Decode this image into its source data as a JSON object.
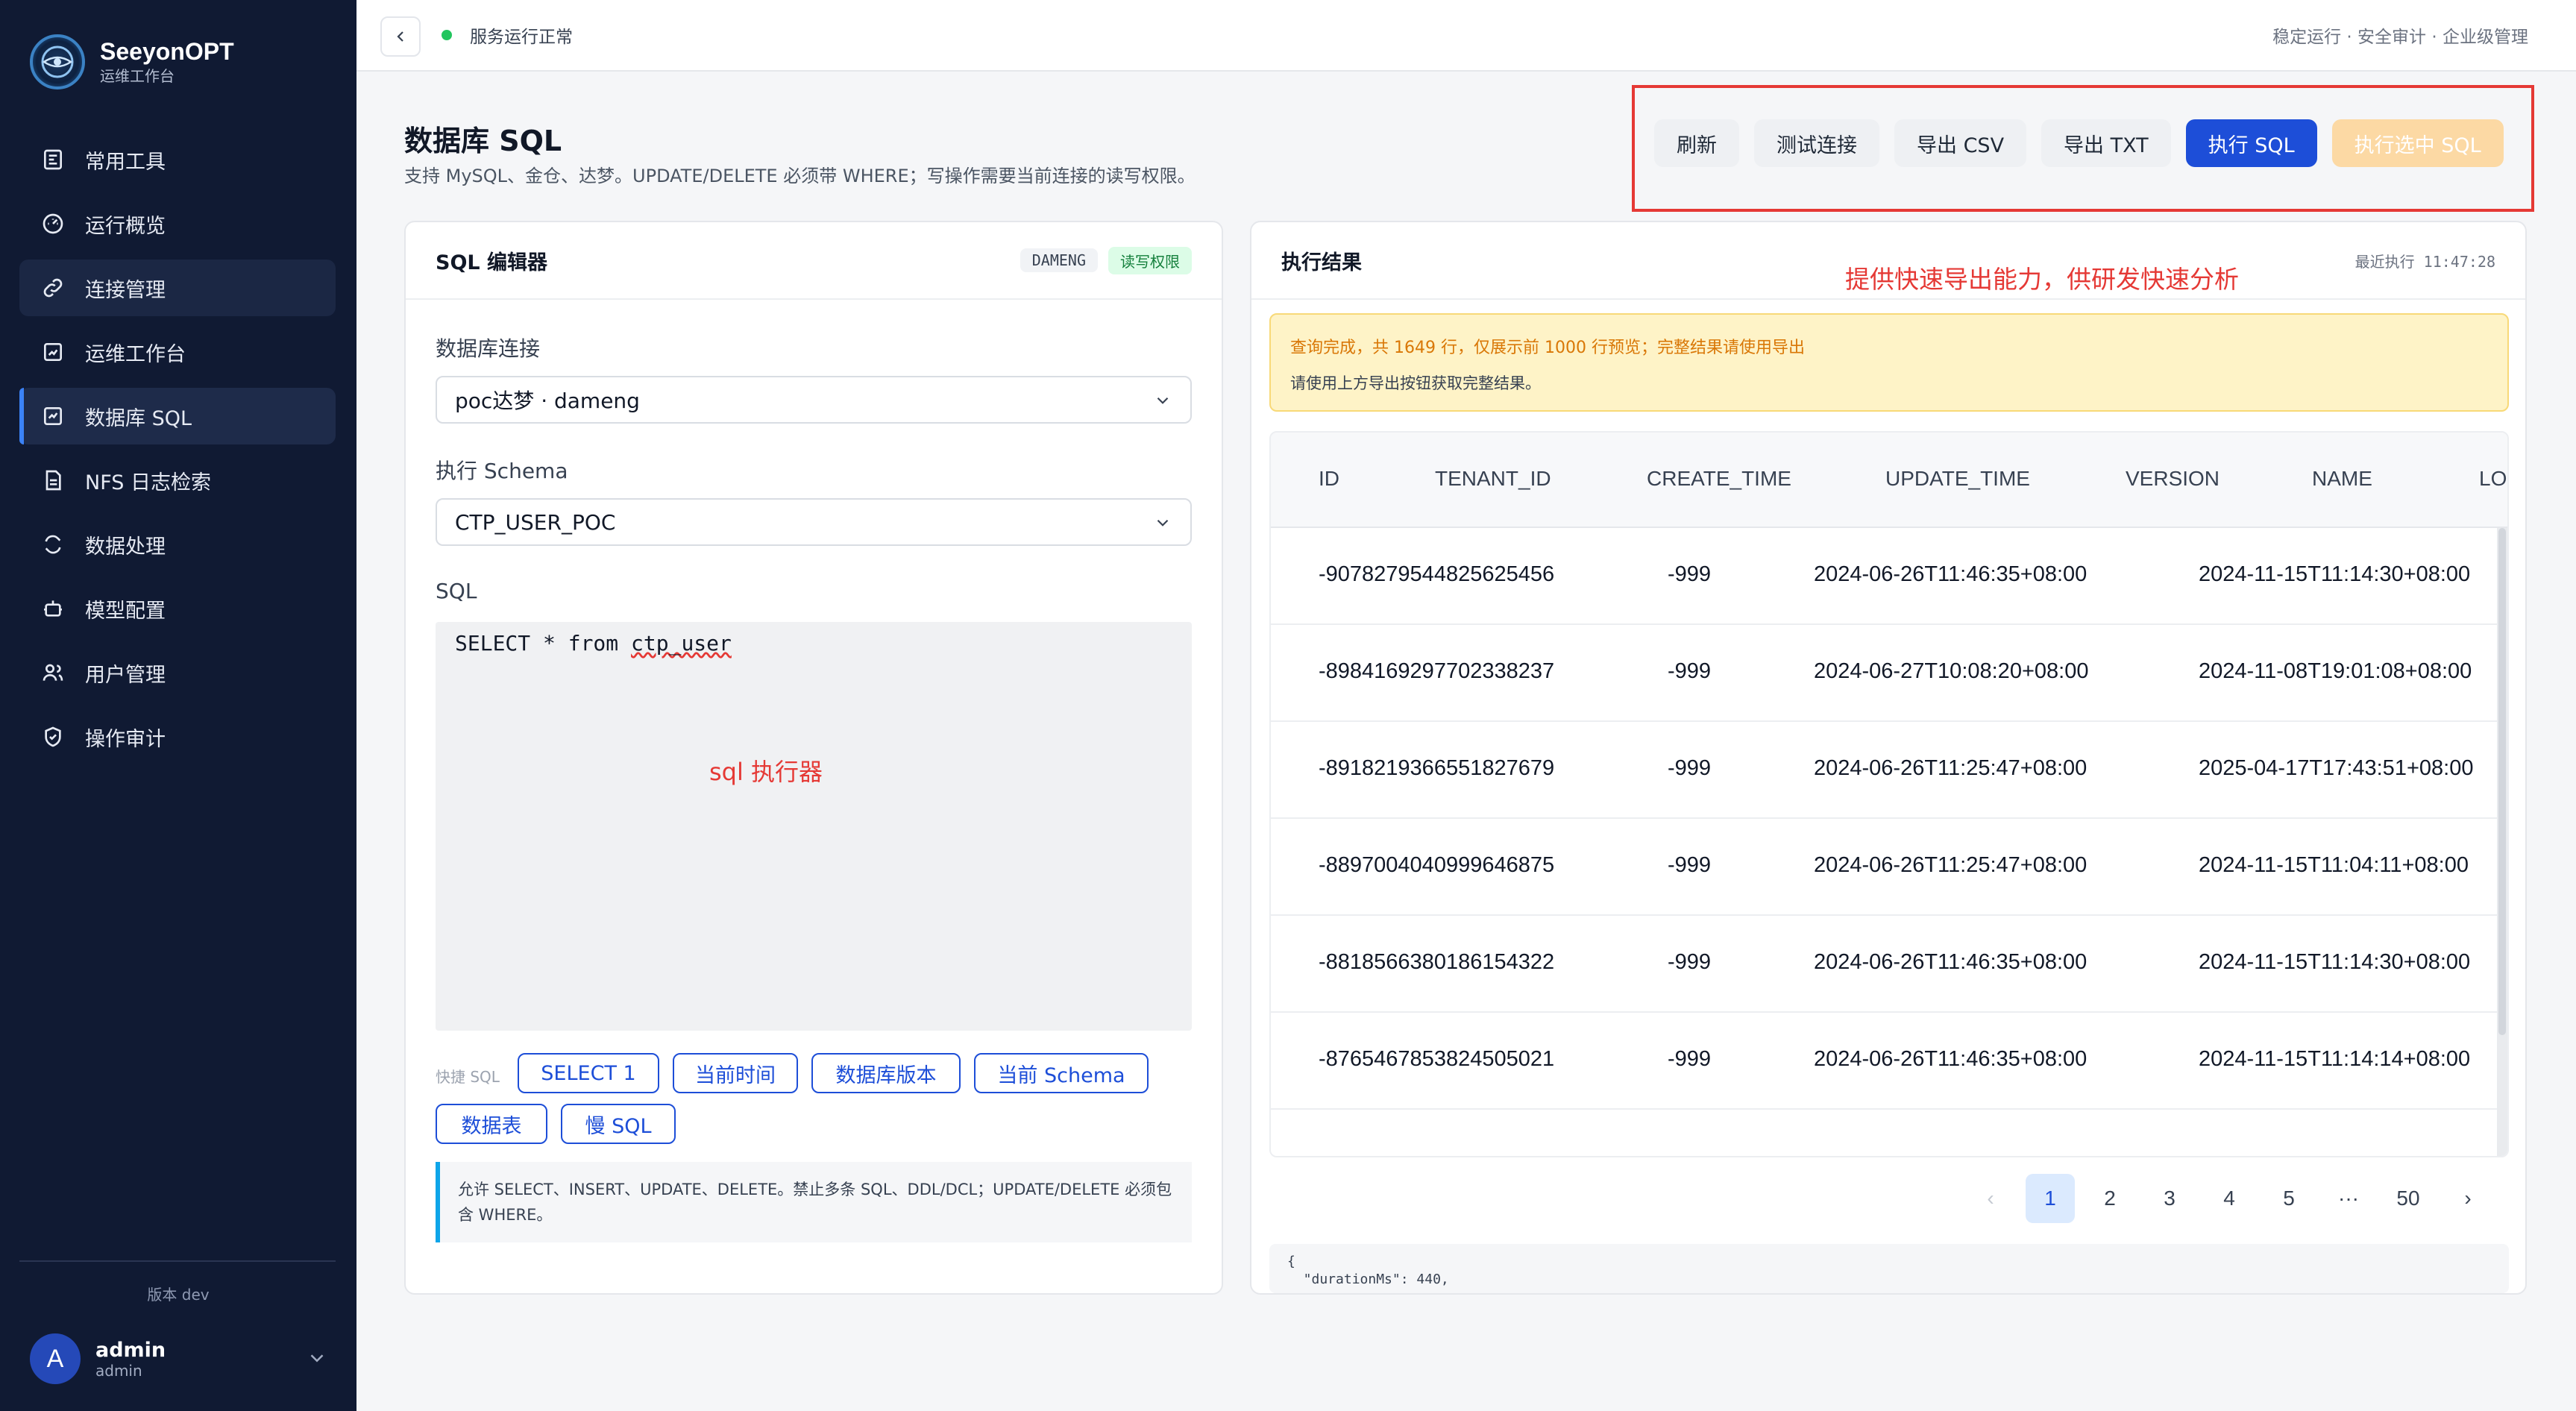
{
  "brand": {
    "title": "SeeyonOPT",
    "subtitle": "运维工作台"
  },
  "sidebar": {
    "items": [
      {
        "label": "常用工具",
        "icon": "tools-icon"
      },
      {
        "label": "运行概览",
        "icon": "gauge-icon"
      },
      {
        "label": "连接管理",
        "icon": "link-icon"
      },
      {
        "label": "运维工作台",
        "icon": "workbench-icon"
      },
      {
        "label": "数据库 SQL",
        "icon": "database-icon"
      },
      {
        "label": "NFS 日志检索",
        "icon": "file-icon"
      },
      {
        "label": "数据处理",
        "icon": "refresh-icon"
      },
      {
        "label": "模型配置",
        "icon": "robot-icon"
      },
      {
        "label": "用户管理",
        "icon": "users-icon"
      },
      {
        "label": "操作审计",
        "icon": "shield-icon"
      }
    ],
    "version": "版本 dev",
    "user": {
      "avatar": "A",
      "name": "admin",
      "role": "admin"
    }
  },
  "topbar": {
    "status": "服务运行正常",
    "tagline": "稳定运行 · 安全审计 · 企业级管理"
  },
  "page": {
    "title": "数据库 SQL",
    "description": "支持 MySQL、金仓、达梦。UPDATE/DELETE 必须带 WHERE；写操作需要当前连接的读写权限。"
  },
  "toolbar": {
    "refresh": "刷新",
    "test_connection": "测试连接",
    "export_csv": "导出 CSV",
    "export_txt": "导出 TXT",
    "execute": "执行 SQL",
    "execute_selected": "执行选中 SQL"
  },
  "editor": {
    "title": "SQL 编辑器",
    "db_badge": "DAMENG",
    "perm_badge": "读写权限",
    "connection_label": "数据库连接",
    "connection_value": "poc达梦 · dameng",
    "schema_label": "执行 Schema",
    "schema_value": "CTP_USER_POC",
    "sql_label": "SQL",
    "sql_prefix": "SELECT * from ",
    "sql_table": "ctp_user",
    "annotation": "sql 执行器",
    "quick_label": "快捷 SQL",
    "quick": [
      "SELECT 1",
      "当前时间",
      "数据库版本",
      "当前 Schema",
      "数据表",
      "慢 SQL"
    ],
    "rule_note": "允许 SELECT、INSERT、UPDATE、DELETE。禁止多条 SQL、DDL/DCL；UPDATE/DELETE 必须包含 WHERE。"
  },
  "result": {
    "title": "执行结果",
    "last_exec": "最近执行 11:47:28",
    "annotation": "提供快速导出能力，供研发快速分析",
    "notice_main": "查询完成，共 1649 行，仅展示前 1000 行预览；完整结果请使用导出",
    "notice_sub": "请使用上方导出按钮获取完整结果。",
    "columns": [
      "ID",
      "TENANT_ID",
      "CREATE_TIME",
      "UPDATE_TIME",
      "VERSION",
      "NAME",
      "LOC"
    ],
    "rows": [
      [
        "-9078279544825625456",
        "-999",
        "2024-06-26T11:46:35+08:00",
        "2024-11-15T11:14:30+08:00"
      ],
      [
        "-8984169297702338237",
        "-999",
        "2024-06-27T10:08:20+08:00",
        "2024-11-08T19:01:08+08:00"
      ],
      [
        "-8918219366551827679",
        "-999",
        "2024-06-26T11:25:47+08:00",
        "2025-04-17T17:43:51+08:00"
      ],
      [
        "-8897004040999646875",
        "-999",
        "2024-06-26T11:25:47+08:00",
        "2024-11-15T11:04:11+08:00"
      ],
      [
        "-8818566380186154322",
        "-999",
        "2024-06-26T11:46:35+08:00",
        "2024-11-15T11:14:30+08:00"
      ],
      [
        "-8765467853824505021",
        "-999",
        "2024-06-26T11:46:35+08:00",
        "2024-11-15T11:14:14+08:00"
      ]
    ],
    "pager": {
      "prev": "‹",
      "pages": [
        "1",
        "2",
        "3",
        "4",
        "5",
        "···",
        "50"
      ],
      "next": "›"
    },
    "json_line1": "{",
    "json_line2": "  \"durationMs\": 440,"
  }
}
